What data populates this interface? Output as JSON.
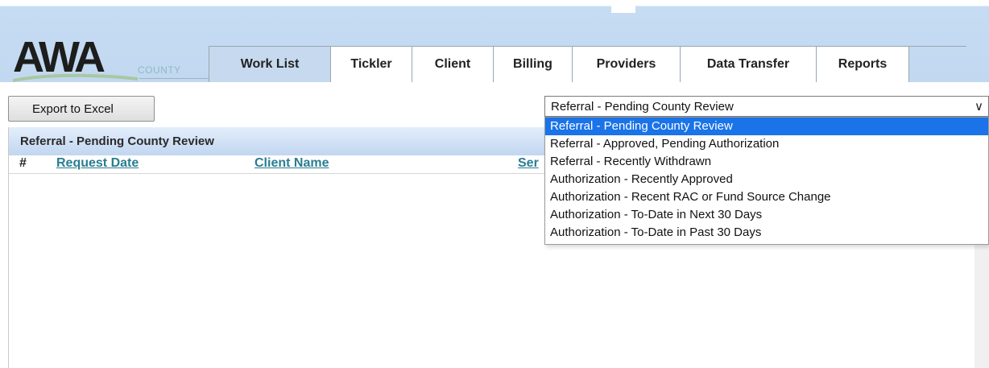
{
  "logo": {
    "wordmark": "AWA",
    "subtitle": "COUNTY"
  },
  "tabs": [
    {
      "label": "Work List",
      "active": true
    },
    {
      "label": "Tickler",
      "active": false
    },
    {
      "label": "Client",
      "active": false
    },
    {
      "label": "Billing",
      "active": false
    },
    {
      "label": "Providers",
      "active": false
    },
    {
      "label": "Data Transfer",
      "active": false
    },
    {
      "label": "Reports",
      "active": false
    }
  ],
  "toolbar": {
    "export_label": "Export to Excel"
  },
  "filter": {
    "selected": "Referral - Pending County Review",
    "options": [
      "Referral - Pending County Review",
      "Referral - Approved, Pending Authorization",
      "Referral - Recently Withdrawn",
      "Authorization - Recently Approved",
      "Authorization - Recent RAC or Fund Source Change",
      "Authorization - To-Date in Next 30 Days",
      "Authorization - To-Date in Past 30 Days"
    ]
  },
  "panel": {
    "title": "Referral - Pending County Review",
    "columns": [
      "#",
      "Request Date",
      "Client Name",
      "Ser"
    ]
  },
  "colors": {
    "tab_active": "#c6d9ee",
    "link": "#2a7d92",
    "option_selected": "#1a73e8"
  }
}
